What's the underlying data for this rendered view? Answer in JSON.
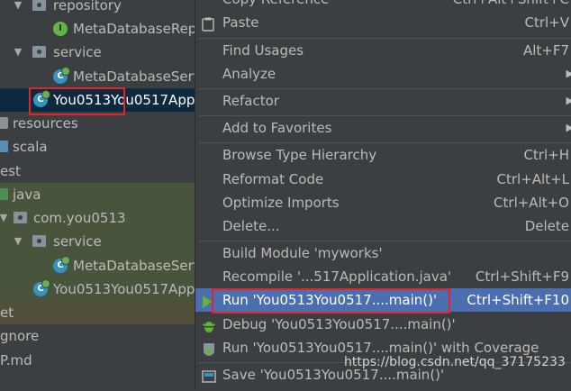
{
  "tree": {
    "items": [
      {
        "label": "repository",
        "icon": "package-folder-icon"
      },
      {
        "label": "MetaDatabaseRep",
        "icon": "interface-class-icon",
        "badge": "I"
      },
      {
        "label": "service",
        "icon": "package-folder-icon"
      },
      {
        "label": "MetaDatabaseServ",
        "icon": "class-icon"
      },
      {
        "label": "You0513You0517App",
        "icon": "spring-boot-class-icon"
      },
      {
        "label": "resources",
        "icon": "resources-folder-icon"
      },
      {
        "label": "scala",
        "icon": "source-folder-icon"
      },
      {
        "label": "est",
        "icon": ""
      },
      {
        "label": "java",
        "icon": "test-source-folder-icon"
      },
      {
        "label": "com.you0513",
        "icon": "package-folder-icon"
      },
      {
        "label": "service",
        "icon": "package-folder-icon"
      },
      {
        "label": "MetaDatabaseServ",
        "icon": "class-icon"
      },
      {
        "label": "You0513You0517App",
        "icon": "spring-boot-class-icon"
      },
      {
        "label": "et",
        "icon": ""
      },
      {
        "label": "gnore",
        "icon": ""
      },
      {
        "label": "P.md",
        "icon": ""
      }
    ]
  },
  "menu": {
    "items": [
      {
        "label": "Copy Reference",
        "shortcut": "Ctrl+Alt+Shift+C"
      },
      {
        "label": "Paste",
        "shortcut": "Ctrl+V"
      },
      {
        "label": "Find Usages",
        "shortcut": "Alt+F7"
      },
      {
        "label": "Analyze",
        "shortcut": ""
      },
      {
        "label": "Refactor",
        "shortcut": ""
      },
      {
        "label": "Add to Favorites",
        "shortcut": ""
      },
      {
        "label": "Browse Type Hierarchy",
        "shortcut": "Ctrl+H"
      },
      {
        "label": "Reformat Code",
        "shortcut": "Ctrl+Alt+L"
      },
      {
        "label": "Optimize Imports",
        "shortcut": "Ctrl+Alt+O"
      },
      {
        "label": "Delete...",
        "shortcut": "Delete"
      },
      {
        "label": "Build Module 'myworks'",
        "shortcut": ""
      },
      {
        "label": "Recompile '...517Application.java'",
        "shortcut": "Ctrl+Shift+F9"
      },
      {
        "label": "Run 'You0513You0517....main()'",
        "shortcut": "Ctrl+Shift+F10"
      },
      {
        "label": "Debug 'You0513You0517....main()'",
        "shortcut": ""
      },
      {
        "label": "Run 'You0513You0517....main()' with Coverage",
        "shortcut": ""
      },
      {
        "label": "Save 'You0513You0517....main()'",
        "shortcut": ""
      }
    ]
  },
  "watermark": "https://blog.csdn.net/qq_37175233",
  "colors": {
    "background": "#3c3f41",
    "selection": "#0d293e",
    "menu_highlight": "#4b6eaf",
    "highlight_box": "#e3242b",
    "test_band": "#49543d",
    "excluded_band": "#52503a"
  }
}
